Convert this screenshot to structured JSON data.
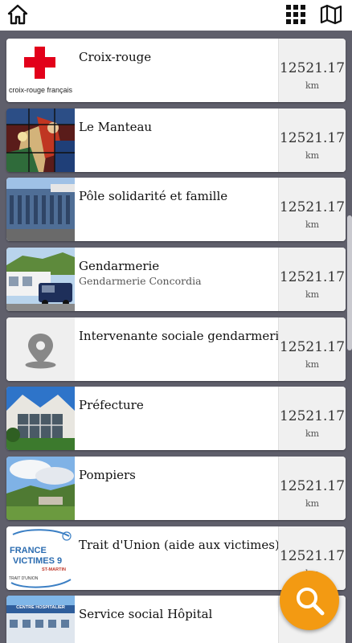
{
  "header": {
    "home_icon": "home-icon",
    "grid_icon": "grid-icon",
    "map_icon": "map-icon"
  },
  "items": [
    {
      "title": "Croix-rouge",
      "subtitle": "",
      "distance": "12521.17",
      "unit": "km",
      "thumb": "croix-rouge-logo",
      "logo_text": "croix-rouge français"
    },
    {
      "title": "Le Manteau",
      "subtitle": "",
      "distance": "12521.17",
      "unit": "km",
      "thumb": "stained-glass-photo"
    },
    {
      "title": "Pôle solidarité et famille",
      "subtitle": "",
      "distance": "12521.17",
      "unit": "km",
      "thumb": "building-photo"
    },
    {
      "title": "Gendarmerie",
      "subtitle": "Gendarmerie Concordia",
      "distance": "12521.17",
      "unit": "km",
      "thumb": "gendarmerie-photo"
    },
    {
      "title": "Intervenante sociale gendarmerie",
      "subtitle": "",
      "distance": "12521.17",
      "unit": "km",
      "thumb": "placeholder-pin"
    },
    {
      "title": "Préfecture",
      "subtitle": "",
      "distance": "12521.17",
      "unit": "km",
      "thumb": "prefecture-photo"
    },
    {
      "title": "Pompiers",
      "subtitle": "",
      "distance": "12521.17",
      "unit": "km",
      "thumb": "landscape-photo"
    },
    {
      "title": "Trait d'Union (aide aux victimes)",
      "subtitle": "",
      "distance": "12521.17",
      "unit": "km",
      "thumb": "france-victimes-logo",
      "logo_text": [
        "FRANCE",
        "VICTIMES 9",
        "ST-MARTIN",
        "TRAIT D'UNION"
      ]
    },
    {
      "title": "Service social Hôpital",
      "subtitle": "",
      "distance": "",
      "unit": "",
      "thumb": "hospital-photo",
      "logo_text": "CENTRE HOSPITALIER"
    }
  ],
  "fab": {
    "icon": "search-icon",
    "color": "#f39a12"
  },
  "colors": {
    "background": "#5f5f6b",
    "distance_panel": "#f0f0f0",
    "accent": "#f39a12",
    "croix_rouge": "#e2001a"
  }
}
